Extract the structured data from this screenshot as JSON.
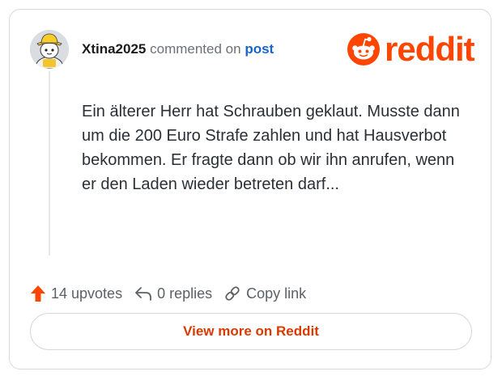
{
  "comment": {
    "username": "Xtina2025",
    "action_text": "commented on",
    "target_link": "post",
    "avatar_icon": "snoo-avatar-yellow-hat",
    "body": "Ein älterer Herr hat Schrauben geklaut. Musste dann um die 200 Euro Strafe zahlen und hat Hausverbot bekommen. Er fragte dann ob wir ihn anrufen, wenn er den Laden wieder betreten darf..."
  },
  "brand": {
    "wordmark": "reddit",
    "icon": "reddit-snoo-icon",
    "color": "#ff4500"
  },
  "actions": {
    "upvotes_label": "14 upvotes",
    "replies_label": "0 replies",
    "copy_label": "Copy link",
    "upvote_color": "#ff4500"
  },
  "footer": {
    "view_more_label": "View more on Reddit",
    "view_more_color": "#d93a00"
  }
}
